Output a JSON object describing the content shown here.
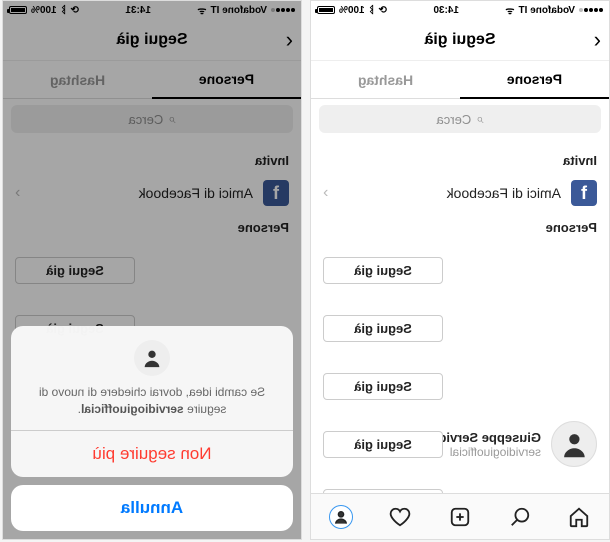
{
  "status": {
    "carrier": "Vodafone IT",
    "time_left": "14:30",
    "time_right": "14:31",
    "battery": "100%",
    "wifi_glyph": "ᯤ",
    "bt_glyph": "ᛒ",
    "lock_glyph": "⟳"
  },
  "nav": {
    "title": "Segui già",
    "back_glyph": "‹"
  },
  "tabs": {
    "left": "Persone",
    "right": "Hashtag"
  },
  "search": {
    "icon": "⌕",
    "placeholder": "Cerca"
  },
  "sections": {
    "invite": "Invita",
    "people": "Persone"
  },
  "fb": {
    "label": "Amici di Facebook",
    "f": "f",
    "chev": "›"
  },
  "follow_label": "Segui già",
  "person": {
    "name": "Giuseppe Servidio",
    "username": "servidiogiuofficial"
  },
  "actionsheet": {
    "message_pre": "Se cambi idea, dovrai chiedere di nuovo di seguire ",
    "message_bold": "servidiogiuofficial",
    "message_post": ".",
    "destructive": "Non seguire più",
    "cancel": "Annulla"
  }
}
